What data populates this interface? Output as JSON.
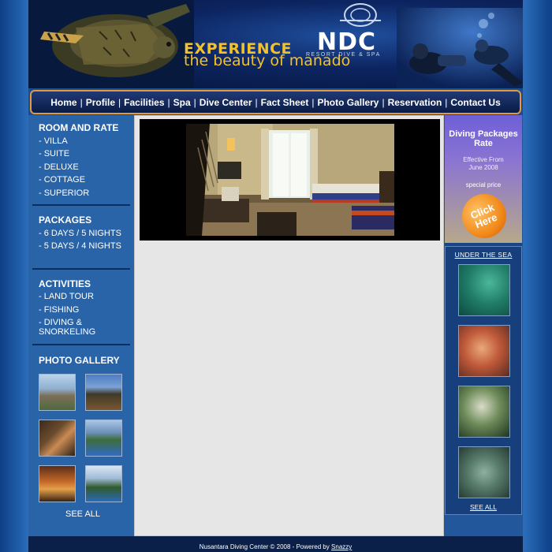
{
  "header": {
    "headline": "EXPERIENCE",
    "brand": "NDC",
    "brand_sub": "RESORT DIVE & SPA",
    "tagline": "the beauty of manado"
  },
  "nav": {
    "items": [
      "Home",
      "Profile",
      "Facilities",
      "Spa",
      "Dive Center",
      "Fact Sheet",
      "Photo Gallery",
      "Reservation",
      "Contact Us"
    ],
    "separator": "|"
  },
  "sidebar": {
    "room_title": "ROOM AND RATE",
    "rooms": [
      "- VILLA",
      "- SUITE",
      "- DELUXE",
      "- COTTAGE",
      "- SUPERIOR"
    ],
    "packages_title": "PACKAGES",
    "packages": [
      "- 6 DAYS / 5 NIGHTS",
      "- 5 DAYS / 4 NIGHTS"
    ],
    "activities_title": "ACTIVITIES",
    "activities": [
      "- LAND TOUR",
      "- FISHING",
      "- DIVING & SNORKELING"
    ],
    "gallery_title": "PHOTO GALLERY",
    "see_all": "SEE ALL"
  },
  "promo": {
    "title_line1": "Diving Packages",
    "title_line2": "Rate",
    "effective_line1": "Effective From",
    "effective_line2": "June 2008",
    "special": "special price",
    "cta_line1": "Click",
    "cta_line2": "Here"
  },
  "sea": {
    "title": "UNDER THE SEA",
    "see_all": "SEE ALL"
  },
  "footer": {
    "text": "Nusantara Diving Center © 2008 - Powered by",
    "link": "Snazzy"
  },
  "colors": {
    "nav_border": "#e39a3f",
    "headline": "#f3c12a",
    "page_bg": "#2a6cb8"
  }
}
